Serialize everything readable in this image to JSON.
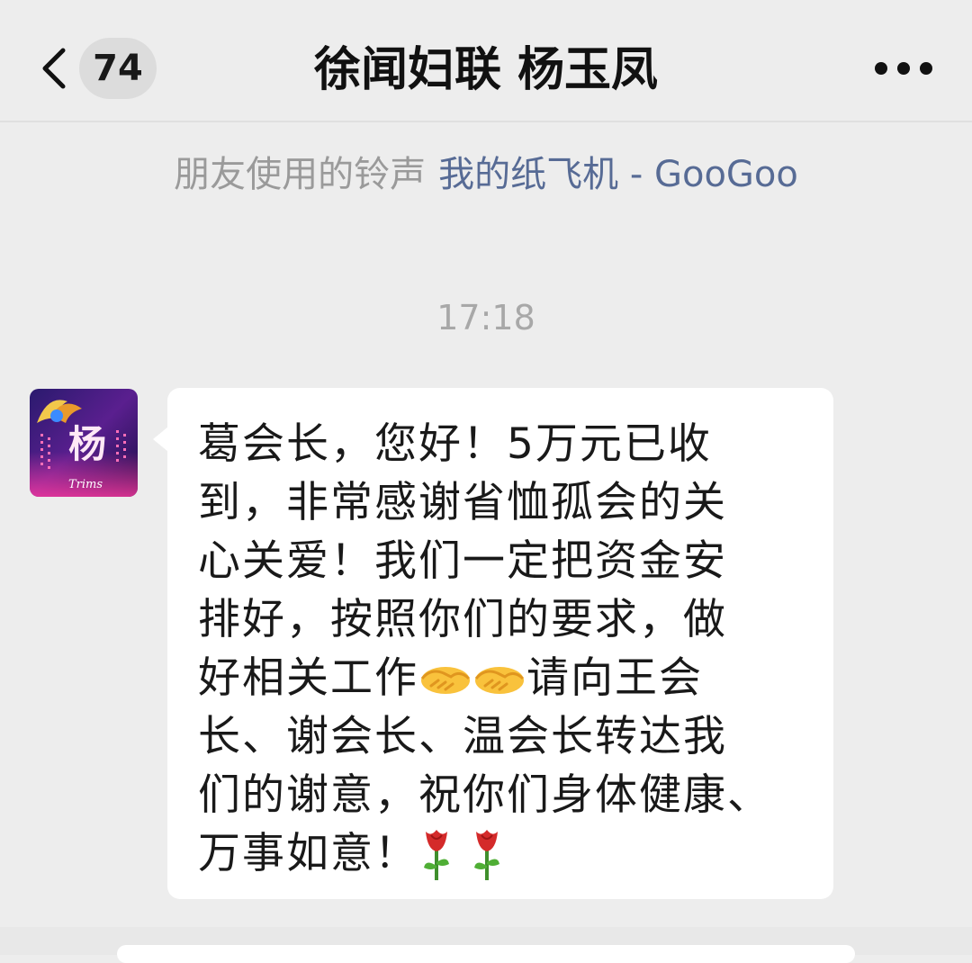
{
  "header": {
    "unread_count": "74",
    "title": "徐闻妇联 杨玉凤"
  },
  "ringtone": {
    "prefix": "朋友使用的铃声",
    "song": "我的纸飞机 - GooGoo"
  },
  "timestamp": "17:18",
  "message": {
    "sender_avatar_char": "杨",
    "sender_avatar_sig": "Trims",
    "lines": [
      "葛会长，您好！5万元已收",
      "到，非常感谢省恤孤会的关",
      "心关爱！我们一定把资金安",
      "排好，按照你们的要求，做"
    ],
    "line5_text": "好相关工作",
    "line5_tail": "请向王会",
    "lines_after": [
      "长、谢会长、温会长转达我",
      "们的谢意，祝你们身体健康、"
    ],
    "last_line_text": "万事如意！",
    "emojis": {
      "handshake": "handshake-emoji",
      "rose": "rose-emoji"
    }
  },
  "colors": {
    "background": "#ededed",
    "bubble": "#ffffff",
    "link": "#576b95",
    "meta_text": "#9a9a9a"
  }
}
